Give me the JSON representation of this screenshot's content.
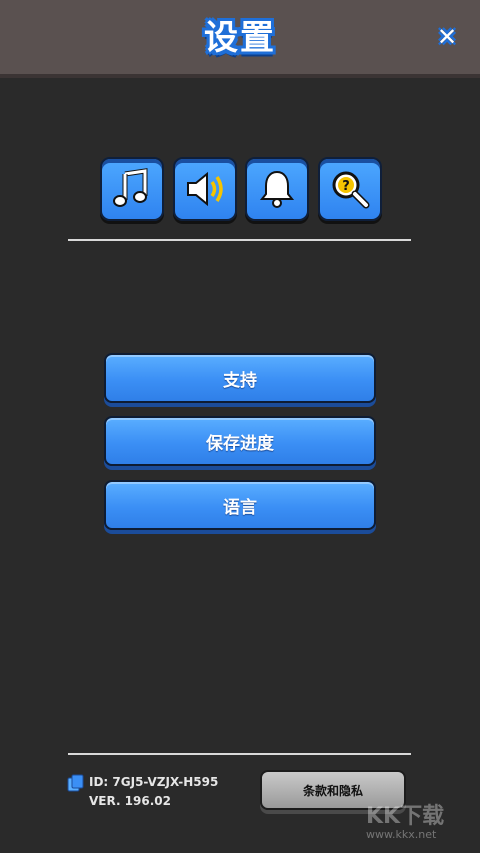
{
  "header": {
    "title": "设置"
  },
  "icons": [
    {
      "name": "music-note-icon"
    },
    {
      "name": "speaker-icon"
    },
    {
      "name": "bell-icon"
    },
    {
      "name": "magnifier-question-icon"
    }
  ],
  "menu": {
    "support_label": "支持",
    "save_progress_label": "保存进度",
    "language_label": "语言"
  },
  "footer": {
    "id_text": "ID: 7GJ5-VZJX-H595",
    "version_text": "VER. 196.02",
    "terms_label": "条款和隐私"
  },
  "watermark": {
    "text": "KK下载",
    "url": "www.kkx.net"
  },
  "colors": {
    "accent_blue": "#3b8ff5",
    "background": "#2a2a2a",
    "header": "#5a5150"
  }
}
